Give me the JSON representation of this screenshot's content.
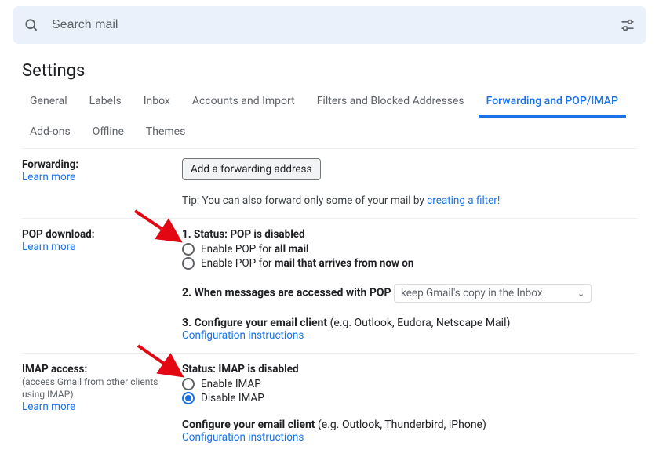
{
  "search": {
    "placeholder": "Search mail"
  },
  "page_title": "Settings",
  "tabs": {
    "t0": "General",
    "t1": "Labels",
    "t2": "Inbox",
    "t3": "Accounts and Import",
    "t4": "Filters and Blocked Addresses",
    "t5": "Forwarding and POP/IMAP",
    "t6": "Add-ons",
    "t7": "Offline",
    "t8": "Themes"
  },
  "forwarding": {
    "label": "Forwarding:",
    "learn_more": "Learn more",
    "button": "Add a forwarding address",
    "tip_prefix": "Tip: You can also forward only some of your mail by ",
    "tip_link": "creating a filter!"
  },
  "pop": {
    "label": "POP download:",
    "learn_more": "Learn more",
    "status": "1. Status: POP is disabled",
    "opt1_prefix": "Enable POP for ",
    "opt1_bold": "all mail",
    "opt2_prefix": "Enable POP for ",
    "opt2_bold": "mail that arrives from now on",
    "step2": "2. When messages are accessed with POP",
    "select_value": "keep Gmail's copy in the Inbox",
    "step3_bold": "3. Configure your email client",
    "step3_rest": " (e.g. Outlook, Eudora, Netscape Mail)",
    "config_link": "Configuration instructions"
  },
  "imap": {
    "label": "IMAP access:",
    "sub": "(access Gmail from other clients using IMAP)",
    "learn_more": "Learn more",
    "status": "Status: IMAP is disabled",
    "opt1": "Enable IMAP",
    "opt2": "Disable IMAP",
    "conf_bold": "Configure your email client",
    "conf_rest": " (e.g. Outlook, Thunderbird, iPhone)",
    "config_link": "Configuration instructions"
  }
}
